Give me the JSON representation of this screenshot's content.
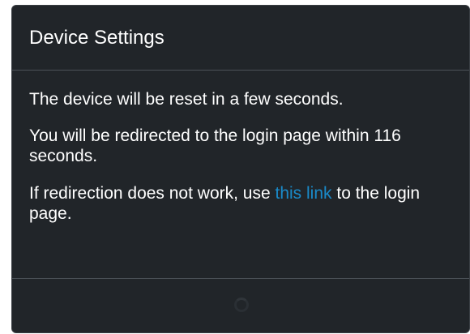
{
  "dialog": {
    "title": "Device Settings",
    "message_reset": "The device will be reset in a few seconds.",
    "message_redirect": "You will be redirected to the login page within 116 seconds.",
    "message_fallback_before": "If redirection does not work, use ",
    "message_fallback_link": "this link",
    "message_fallback_after": " to the login page."
  },
  "colors": {
    "background": "#212529",
    "link": "#1a8ac9",
    "divider": "#4b5157"
  },
  "icons": {
    "loading": "loading-spinner-icon"
  }
}
